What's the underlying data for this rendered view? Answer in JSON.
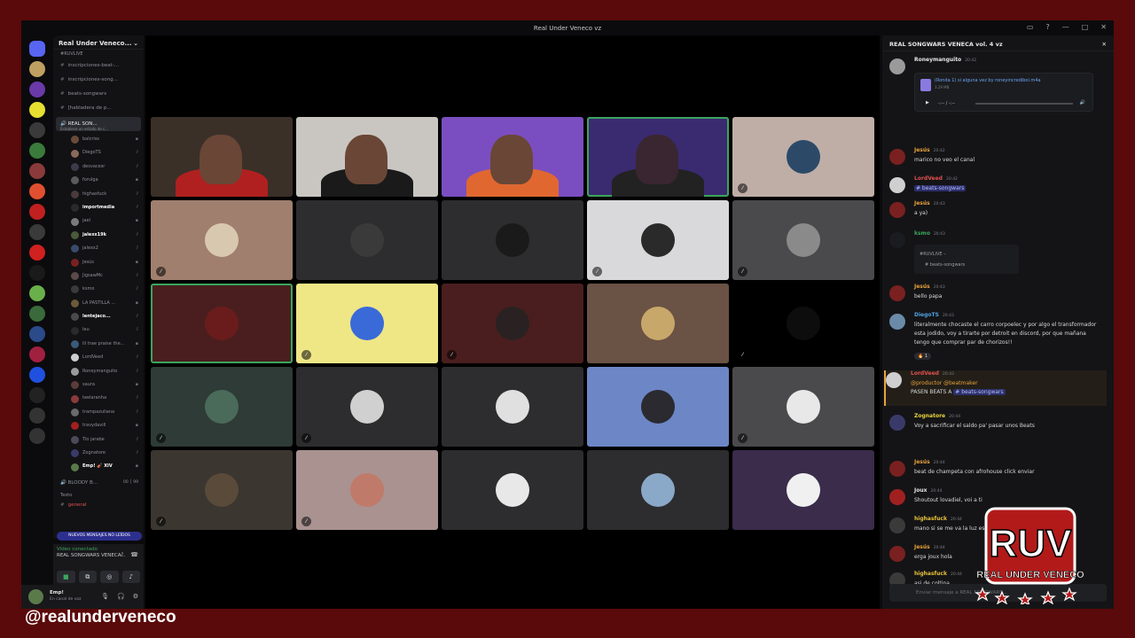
{
  "window": {
    "title": "Real Under Veneco vz"
  },
  "server": {
    "name": "Real Under Veneco..."
  },
  "channels": {
    "category": "#RUVLIVE",
    "items": [
      {
        "label": "inscripciones-beat-..."
      },
      {
        "label": "inscripciones-song..."
      },
      {
        "label": "beats-songwars"
      },
      {
        "label": "[habladera de p..."
      }
    ],
    "voice_channel": {
      "label": "REAL SON...",
      "status": "Establece un estado de c..."
    },
    "members": [
      "balcriss",
      "DiegoTS",
      "desvacesr",
      "forulga",
      "highasfuck",
      "importmedia",
      "jael",
      "jalexx19k",
      "jalexx2",
      "Jesús",
      "JigsawMc",
      "ksmo",
      "LA PASTILLA ...",
      "lentejaco...",
      "leu",
      "lil trae praise the...",
      "LordVeed",
      "Roneymanguito",
      "saura",
      "teelaranha",
      "trampazuliana",
      "travydavill",
      "Tio jarabe",
      "Zognatore",
      "Emp! 🎻 XIV"
    ],
    "second_voice": "BLOODY B...",
    "second_voice_counts": "00 │ 99",
    "text_category": "Texto",
    "general": "general",
    "new_messages": "NUEVOS MENSAJES NO LEÍDOS"
  },
  "voice_panel": {
    "status": "Vídeo conectado",
    "channel": "REAL SONGWARS VENECA..."
  },
  "user": {
    "name": "Emp!",
    "status": "En canal de voz"
  },
  "grid": {
    "tiles": [
      {
        "type": "camera",
        "bg": "#3a3028",
        "speaking": false,
        "muted": false
      },
      {
        "type": "camera",
        "bg": "#c9c6c2",
        "speaking": false,
        "muted": false
      },
      {
        "type": "camera",
        "bg": "#7a4ec0",
        "speaking": false,
        "muted": false
      },
      {
        "type": "camera",
        "bg": "#3a2a70",
        "speaking": true,
        "muted": false
      },
      {
        "type": "avatar",
        "bg": "#bfaea6",
        "speaking": false,
        "muted": true,
        "av": "#2c4a68"
      },
      {
        "type": "avatar",
        "bg": "#a07f6e",
        "speaking": false,
        "muted": true,
        "av": "#d8c8b0"
      },
      {
        "type": "avatar",
        "bg": "#2d2d2f",
        "speaking": false,
        "muted": false,
        "av": "#3a3a3a"
      },
      {
        "type": "avatar",
        "bg": "#2d2d2f",
        "speaking": false,
        "muted": false,
        "av": "#1a1a1a"
      },
      {
        "type": "avatar",
        "bg": "#d9d9db",
        "speaking": false,
        "muted": true,
        "av": "#2a2a2a"
      },
      {
        "type": "avatar",
        "bg": "#4a4a4c",
        "speaking": false,
        "muted": true,
        "av": "#8a8a8a"
      },
      {
        "type": "avatar",
        "bg": "#4a1e1e",
        "speaking": true,
        "muted": false,
        "av": "#6a1c1c"
      },
      {
        "type": "avatar",
        "bg": "#efe686",
        "speaking": false,
        "muted": true,
        "av": "#3a6ad8"
      },
      {
        "type": "avatar",
        "bg": "#4a1e1e",
        "speaking": false,
        "muted": true,
        "av": "#2a2222"
      },
      {
        "type": "avatar",
        "bg": "#6a5244",
        "speaking": false,
        "muted": false,
        "av": "#c8a86a"
      },
      {
        "type": "avatar",
        "bg": "#000000",
        "speaking": false,
        "muted": true,
        "av": "#0d0d0d"
      },
      {
        "type": "avatar",
        "bg": "#2e3b36",
        "speaking": false,
        "muted": true,
        "av": "#4a6a5a"
      },
      {
        "type": "avatar",
        "bg": "#2d2d2f",
        "speaking": false,
        "muted": true,
        "av": "#d0d0d0"
      },
      {
        "type": "avatar",
        "bg": "#2d2d2f",
        "speaking": false,
        "muted": false,
        "av": "#e0e0e0"
      },
      {
        "type": "avatar",
        "bg": "#6d86c6",
        "speaking": false,
        "muted": false,
        "av": "#2a2a30"
      },
      {
        "type": "avatar",
        "bg": "#4a4a4c",
        "speaking": false,
        "muted": true,
        "av": "#e8e8e8"
      },
      {
        "type": "avatar",
        "bg": "#3b3630",
        "speaking": false,
        "muted": true,
        "av": "#5a4a3a"
      },
      {
        "type": "avatar",
        "bg": "#a99290",
        "speaking": false,
        "muted": true,
        "av": "#c07a6a"
      },
      {
        "type": "avatar",
        "bg": "#2d2d2f",
        "speaking": false,
        "muted": false,
        "av": "#e8e8e8"
      },
      {
        "type": "avatar",
        "bg": "#2d2d2f",
        "speaking": false,
        "muted": false,
        "av": "#8aa8c8"
      },
      {
        "type": "avatar",
        "bg": "#3a2c4a",
        "speaking": false,
        "muted": false,
        "av": "#f0f0f0"
      }
    ]
  },
  "chat": {
    "title": "REAL SONGWARS VENECA vol. 4 vz",
    "attachment": {
      "name": "(Ronda 1) si alguna vez by roneyincrediboi.m4a",
      "size": "3.29 MB",
      "time": "-:-- / -:--"
    },
    "messages": [
      {
        "author": "Roneymanguito",
        "time": "20:42",
        "text": "",
        "color": "#e6e6e8",
        "av": "#9a9a9a"
      },
      {
        "author": "Jesús",
        "time": "20:42",
        "text": "marico no veo el canal",
        "color": "#e8a23a",
        "av": "#7a2020"
      },
      {
        "author": "LordVeed",
        "time": "20:42",
        "text": "",
        "color": "#e05050",
        "av": "#cfcfcf",
        "mention": "# beats-songwars"
      },
      {
        "author": "Jesús",
        "time": "20:43",
        "text": "a ya)",
        "color": "#e8a23a",
        "av": "#7a2020"
      },
      {
        "author": "ksmo",
        "time": "20:43",
        "text": "",
        "color": "#3ba55d",
        "av": "#1b1c1f"
      },
      {
        "author": "Jesús",
        "time": "20:43",
        "text": "bello papa",
        "color": "#e8a23a",
        "av": "#7a2020"
      },
      {
        "author": "DiegoTS",
        "time": "20:43",
        "text": "literalmente chocaste el carro corpoelec y por algo el transformador esta jodido, voy a tirarte por detroit en discord, por que mañana tengo que comprar par de chorizos!!",
        "color": "#4fa3e0",
        "av": "#6a8aa8"
      },
      {
        "author": "LordVeed",
        "time": "20:43",
        "text": "PASEN BEATS A",
        "color": "#e05050",
        "av": "#cfcfcf",
        "mention": "# beats-songwars",
        "mentions_top": "@productor @beatmaker"
      },
      {
        "author": "Zognatore",
        "time": "20:44",
        "text": "Voy a sacrificar el saldo pa' pasar unos Beats",
        "color": "#e8d23a",
        "av": "#3a3a6a"
      },
      {
        "author": "Jesús",
        "time": "20:44",
        "text": "beat de champeta con afrohouse click enviar",
        "color": "#e8a23a",
        "av": "#7a2020"
      },
      {
        "author": "Joux",
        "time": "20:44",
        "text": "Shoutout lovadiel, voi a ti",
        "color": "#e6e6e8",
        "av": "#a02020"
      },
      {
        "author": "highasfuck",
        "time": "20:44",
        "text": "mano si se me va la luz es",
        "color": "#e8c23a",
        "av": "#3a3a3a"
      },
      {
        "author": "Jesús",
        "time": "20:44",
        "text": "erga joux hola",
        "color": "#e8a23a",
        "av": "#7a2020"
      },
      {
        "author": "highasfuck",
        "time": "20:44",
        "text": "asi de coltina",
        "color": "#e8c23a",
        "av": "#3a3a3a"
      }
    ],
    "embed": {
      "line1": "#RUVLIVE –",
      "line2": "# beats-songwars"
    },
    "reactions": {
      "a": "🔥 1"
    },
    "input_placeholder": "Enviar mensaje a REAL SONGWARS..."
  },
  "overlay": {
    "handle": "@realunderveneco",
    "logo_text": "REAL UNDER VENECO",
    "logo_mark": "RUV"
  }
}
